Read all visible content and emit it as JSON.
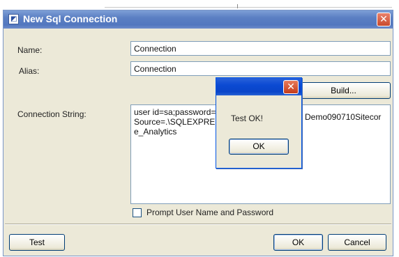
{
  "dialog": {
    "title": "New Sql Connection",
    "title_icon": "connection-icon",
    "close_glyph": "✕",
    "name_label": "Name:",
    "name_value": "Connection",
    "alias_label": "Alias:",
    "alias_value": "Connection",
    "build_button": "Build...",
    "conn_label": "Connection String:",
    "conn_line1": "user id=sa;password=",
    "conn_line1b": "Demo090710Sitecor",
    "conn_line2": "Source=.\\SQLEXPRE",
    "conn_line3": "e_Analytics",
    "prompt_label": "Prompt User Name and Password",
    "prompt_checked": false,
    "test_button": "Test",
    "ok_button": "OK",
    "cancel_button": "Cancel"
  },
  "message_box": {
    "close_glyph": "✕",
    "message": "Test OK!",
    "ok_button": "OK"
  },
  "colors": {
    "title_gradient": "#5b7fc3",
    "msg_title_gradient": "#0b4ad3",
    "dialog_bg": "#ece9d8",
    "close_red": "#c94a2d"
  }
}
